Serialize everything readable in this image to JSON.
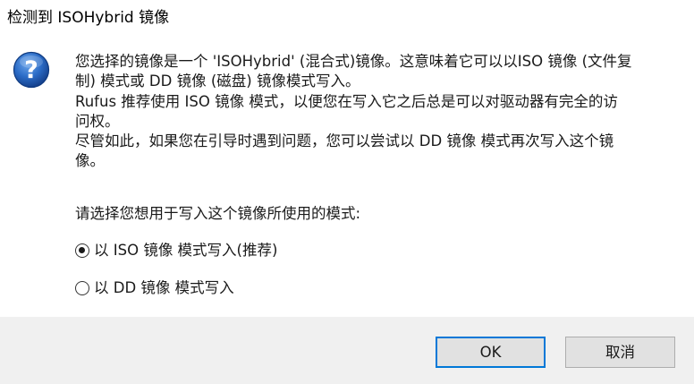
{
  "window": {
    "title": "检测到 ISOHybrid 镜像"
  },
  "icon": {
    "name": "question-icon",
    "glyph": "?",
    "color": "#1f5fb4"
  },
  "message": {
    "line1": "您选择的镜像是一个 'ISOHybrid' (混合式)镜像。这意味着它可以以ISO 镜像 (文件复",
    "line2": "制) 模式或 DD 镜像 (磁盘) 镜像模式写入。",
    "line3": "Rufus 推荐使用 ISO 镜像 模式，以便您在写入它之后总是可以对驱动器有完全的访",
    "line4": "问权。",
    "line5": "尽管如此，如果您在引导时遇到问题，您可以尝试以 DD 镜像 模式再次写入这个镜",
    "line6": "像。"
  },
  "prompt": "请选择您想用于写入这个镜像所使用的模式:",
  "options": {
    "iso": {
      "label": "以 ISO 镜像 模式写入(推荐)",
      "selected": true
    },
    "dd": {
      "label": "以 DD 镜像 模式写入",
      "selected": false
    }
  },
  "buttons": {
    "ok": "OK",
    "cancel": "取消"
  },
  "colors": {
    "footer_bg": "#f0f0f0",
    "focus_border": "#0078d7",
    "button_bg": "#e1e1e1"
  }
}
